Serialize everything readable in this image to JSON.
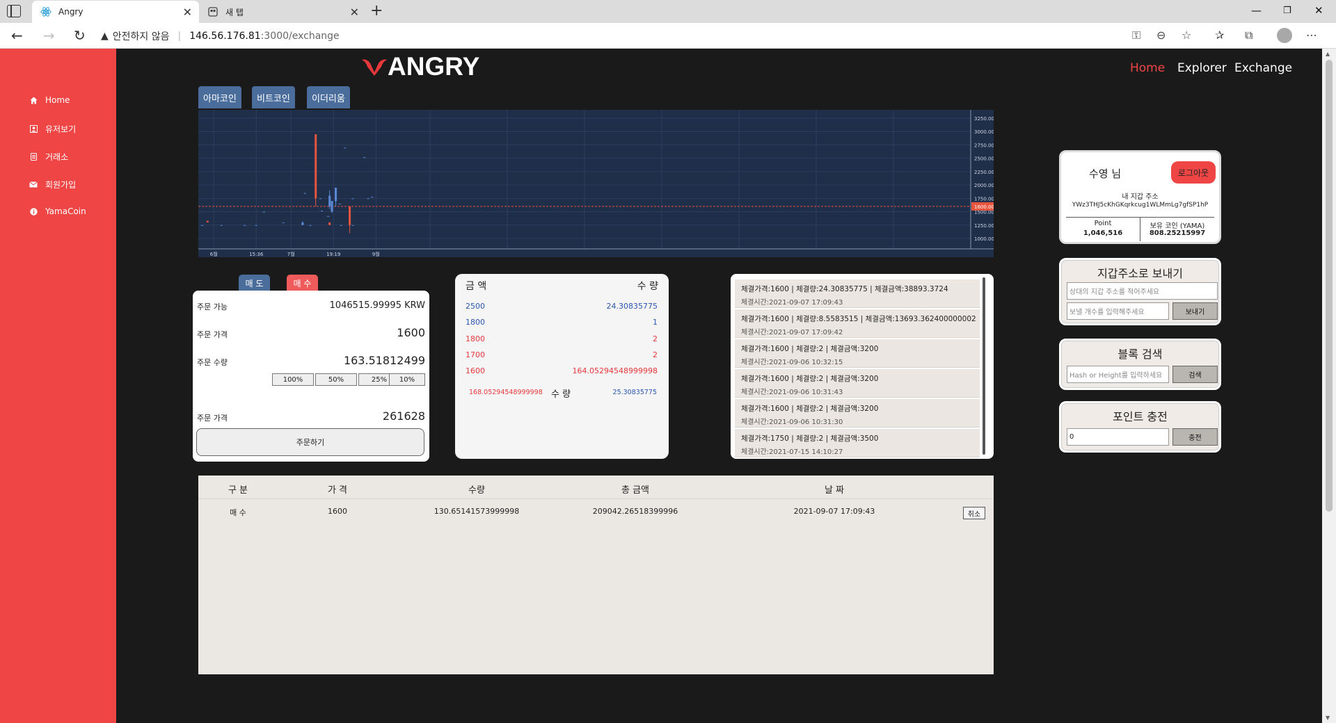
{
  "browser": {
    "tabs": [
      {
        "title": "Angry",
        "active": true
      },
      {
        "title": "새 탭",
        "active": false
      }
    ],
    "url_warning": "안전하지 않음",
    "url_host": "146.56.176.81",
    "url_path": ":3000/exchange"
  },
  "sidebar": {
    "items": [
      {
        "label": "Home",
        "icon": "home-icon"
      },
      {
        "label": "유저보기",
        "icon": "user-icon"
      },
      {
        "label": "거래소",
        "icon": "exchange-icon"
      },
      {
        "label": "회원가입",
        "icon": "mail-icon"
      },
      {
        "label": "YamaCoin",
        "icon": "info-icon"
      }
    ]
  },
  "header": {
    "logo_text": "ANGRY",
    "nav": [
      {
        "label": "Home",
        "active": true
      },
      {
        "label": "Explorer",
        "active": false
      },
      {
        "label": "Exchange",
        "active": false
      }
    ]
  },
  "coin_tabs": [
    "아마코인",
    "비트코인",
    "이더리움"
  ],
  "chart_data": {
    "type": "candlestick",
    "y_ticks": [
      "3250.00",
      "3000.00",
      "2750.00",
      "2500.00",
      "2250.00",
      "2000.00",
      "1750.00",
      "1500.00",
      "1250.00",
      "1000.00"
    ],
    "x_ticks": [
      "6월",
      "15:36",
      "7월",
      "19:19",
      "9월"
    ],
    "current_price_label": "1600.00",
    "ylim": [
      1000,
      3250
    ],
    "background": "#1f2f4a",
    "up_color": "#5b8ad8",
    "down_color": "#e8553e",
    "marks": [
      {
        "x": 0.005,
        "o": 1250,
        "c": 1250,
        "h": 1250,
        "l": 1250
      },
      {
        "x": 0.012,
        "o": 1330,
        "c": 1300,
        "h": 1330,
        "l": 1300
      },
      {
        "x": 0.03,
        "o": 1250,
        "c": 1250,
        "h": 1250,
        "l": 1250
      },
      {
        "x": 0.06,
        "o": 1250,
        "c": 1250,
        "h": 1250,
        "l": 1250
      },
      {
        "x": 0.085,
        "o": 1500,
        "c": 1500,
        "h": 1500,
        "l": 1500
      },
      {
        "x": 0.075,
        "o": 1250,
        "c": 1250,
        "h": 1250,
        "l": 1250
      },
      {
        "x": 0.11,
        "o": 1300,
        "c": 1300,
        "h": 1300,
        "l": 1300
      },
      {
        "x": 0.135,
        "o": 1250,
        "c": 1300,
        "h": 1320,
        "l": 1250
      },
      {
        "x": 0.145,
        "o": 1250,
        "c": 1250,
        "h": 1250,
        "l": 1250
      },
      {
        "x": 0.16,
        "o": 1520,
        "c": 1520,
        "h": 1520,
        "l": 1520
      },
      {
        "x": 0.17,
        "o": 1300,
        "c": 1250,
        "h": 1300,
        "l": 1250
      },
      {
        "x": 0.185,
        "o": 1250,
        "c": 1250,
        "h": 1250,
        "l": 1250
      },
      {
        "x": 0.2,
        "o": 1250,
        "c": 1250,
        "h": 1250,
        "l": 1250
      },
      {
        "x": 0.138,
        "o": 1850,
        "c": 1850,
        "h": 1850,
        "l": 1850
      },
      {
        "x": 0.152,
        "o": 2950,
        "c": 1750,
        "h": 2950,
        "l": 1600
      },
      {
        "x": 0.158,
        "o": 1750,
        "c": 1750,
        "h": 1750,
        "l": 1750
      },
      {
        "x": 0.168,
        "o": 1420,
        "c": 1420,
        "h": 1420,
        "l": 1420
      },
      {
        "x": 0.17,
        "o": 1600,
        "c": 1800,
        "h": 1900,
        "l": 1550
      },
      {
        "x": 0.173,
        "o": 1500,
        "c": 1700,
        "h": 1700,
        "l": 1480
      },
      {
        "x": 0.178,
        "o": 1700,
        "c": 1950,
        "h": 1950,
        "l": 1600
      },
      {
        "x": 0.183,
        "o": 1650,
        "c": 1650,
        "h": 1650,
        "l": 1650
      },
      {
        "x": 0.19,
        "o": 2700,
        "c": 2700,
        "h": 2700,
        "l": 2700
      },
      {
        "x": 0.196,
        "o": 1600,
        "c": 1250,
        "h": 1600,
        "l": 1100
      },
      {
        "x": 0.2,
        "o": 1750,
        "c": 1750,
        "h": 1750,
        "l": 1750
      },
      {
        "x": 0.215,
        "o": 2520,
        "c": 2520,
        "h": 2520,
        "l": 2520
      },
      {
        "x": 0.22,
        "o": 1750,
        "c": 1750,
        "h": 1750,
        "l": 1750
      },
      {
        "x": 0.225,
        "o": 1780,
        "c": 1780,
        "h": 1780,
        "l": 1780
      }
    ]
  },
  "order_form": {
    "sell_label": "매 도",
    "buy_label": "매 수",
    "available_label": "주문 가능",
    "available_value": "1046515.99995 KRW",
    "price_label": "주문 가격",
    "price_value": "1600",
    "qty_label": "주문 수량",
    "qty_value": "163.51812499",
    "pct_buttons": [
      "100%",
      "50%",
      "25%",
      "10%"
    ],
    "total_label": "주문 가격",
    "total_value": "261628",
    "submit_label": "주문하기"
  },
  "order_book": {
    "col_amount": "금 액",
    "col_qty": "수 량",
    "rows": [
      {
        "price": "2500",
        "qty": "24.30835775",
        "side": "sell"
      },
      {
        "price": "1800",
        "qty": "1",
        "side": "sell"
      },
      {
        "price": "1800",
        "qty": "2",
        "side": "buy"
      },
      {
        "price": "1700",
        "qty": "2",
        "side": "buy"
      },
      {
        "price": "1600",
        "qty": "164.05294548999998",
        "side": "buy"
      }
    ],
    "buy_total": "168.05294548999998",
    "middle_label": "수 량",
    "sell_total": "25.30835775"
  },
  "trade_history": [
    {
      "line1": "체결가격:1600 | 체결량:24.30835775 | 체결금액:38893.3724",
      "line2": "체결시간:2021-09-07 17:09:43"
    },
    {
      "line1": "체결가격:1600 | 체결량:8.5583515 | 체결금액:13693.362400000002",
      "line2": "체결시간:2021-09-07 17:09:42"
    },
    {
      "line1": "체결가격:1600 | 체결량:2 | 체결금액:3200",
      "line2": "체결시간:2021-09-06 10:32:15"
    },
    {
      "line1": "체결가격:1600 | 체결량:2 | 체결금액:3200",
      "line2": "체결시간:2021-09-06 10:31:43"
    },
    {
      "line1": "체결가격:1600 | 체결량:2 | 체결금액:3200",
      "line2": "체결시간:2021-09-06 10:31:30"
    },
    {
      "line1": "체결가격:1750 | 체결량:2 | 체결금액:3500",
      "line2": "체결시간:2021-07-15 14:10:27"
    }
  ],
  "my_orders": {
    "headers": [
      "구 분",
      "가 격",
      "수량",
      "총 금액",
      "날 짜"
    ],
    "rows": [
      {
        "type": "매 수",
        "price": "1600",
        "qty": "130.65141573999998",
        "total": "209042.26518399996",
        "date": "2021-09-07 17:09:43",
        "action": "취소"
      }
    ]
  },
  "user_panel": {
    "name": "수영  님",
    "logout_label": "로그아웃",
    "wallet_label": "내 지갑 주소",
    "wallet_address": "YWz3THJ5cKhGKqrkcug1WLMmLg7gfSP1hP",
    "point_label": "Point",
    "point_value": "1,046,516",
    "coin_label": "보유 코인 (YAMA)",
    "coin_value": "808.25215997"
  },
  "send_panel": {
    "title": "지갑주소로 보내기",
    "address_placeholder": "상대의 지갑 주소를 적어주세요",
    "amount_placeholder": "보낼 개수를 입력해주세요",
    "send_label": "보내기"
  },
  "block_panel": {
    "title": "블록 검색",
    "placeholder": "Hash or Height를 입력하세요",
    "search_label": "검색"
  },
  "charge_panel": {
    "title": "포인트 충전",
    "value": "0",
    "charge_label": "충전"
  }
}
